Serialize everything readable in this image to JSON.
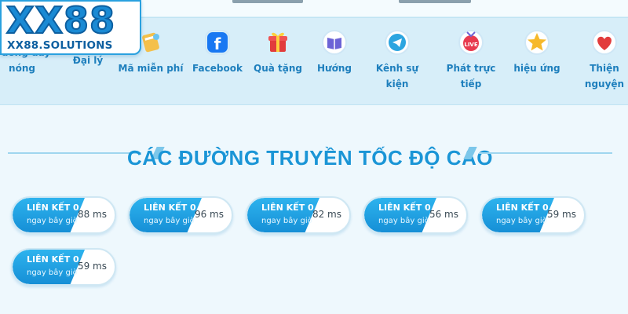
{
  "logo": {
    "main": "XX88",
    "sub": "XX88.SOLUTIONS"
  },
  "nav": {
    "items": [
      {
        "label": "Đường dây nóng",
        "icon": "phone-icon"
      },
      {
        "label": "Đại lý",
        "icon": "agent-icon"
      },
      {
        "label": "Mã miễn phí",
        "icon": "coupon-icon"
      },
      {
        "label": "Facebook",
        "icon": "facebook-icon"
      },
      {
        "label": "Quà tặng",
        "icon": "gift-icon"
      },
      {
        "label": "Hướng",
        "icon": "book-icon"
      },
      {
        "label": "Kênh sự kiện",
        "icon": "telegram-icon"
      },
      {
        "label": "Phát trực tiếp",
        "icon": "live-icon"
      },
      {
        "label": "hiệu ứng",
        "icon": "star-icon"
      },
      {
        "label": "Thiện nguyện",
        "icon": "heart-hands-icon"
      }
    ]
  },
  "section": {
    "title": "CÁC ĐƯỜNG TRUYỀN TỐC ĐỘ CAO"
  },
  "links": [
    {
      "label": "LIÊN KẾT 0",
      "time": "ngay bây giờ",
      "latency": "88 ms"
    },
    {
      "label": "LIÊN KẾT 0",
      "time": "ngay bây giờ",
      "latency": "96 ms"
    },
    {
      "label": "LIÊN KẾT 0",
      "time": "ngay bây giờ",
      "latency": "82 ms"
    },
    {
      "label": "LIÊN KẾT 0",
      "time": "ngay bây giờ",
      "latency": "56 ms"
    },
    {
      "label": "LIÊN KẾT 0",
      "time": "ngay bây giờ",
      "latency": "59 ms"
    },
    {
      "label": "LIÊN KẾT 0",
      "time": "ngay bây giờ",
      "latency": "59 ms"
    }
  ],
  "colors": {
    "accent": "#1a95d6",
    "nav_text": "#1e7fbd",
    "nav_band": "#d7eef9",
    "pill_gradient_top": "#2db3ee",
    "pill_gradient_bottom": "#168fd6"
  }
}
